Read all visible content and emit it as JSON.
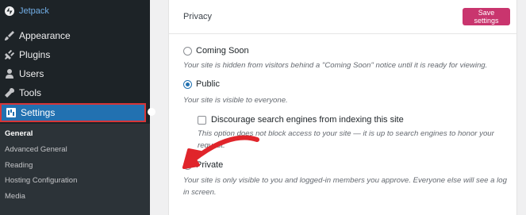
{
  "sidebar": {
    "items": [
      {
        "label": "Jetpack",
        "icon": "jetpack-icon"
      },
      {
        "label": "Appearance",
        "icon": "paintbrush-icon"
      },
      {
        "label": "Plugins",
        "icon": "plug-icon"
      },
      {
        "label": "Users",
        "icon": "users-icon"
      },
      {
        "label": "Tools",
        "icon": "wrench-icon"
      },
      {
        "label": "Settings",
        "icon": "settings-icon"
      }
    ],
    "submenu": [
      "General",
      "Advanced General",
      "Reading",
      "Hosting Configuration",
      "Media"
    ]
  },
  "privacy": {
    "title": "Privacy",
    "save_label": "Save settings",
    "coming_soon_label": "Coming Soon",
    "coming_soon_desc": "Your site is hidden from visitors behind a \"Coming Soon\" notice until it is ready for viewing.",
    "public_label": "Public",
    "public_desc": "Your site is visible to everyone.",
    "discourage_label": "Discourage search engines from indexing this site",
    "discourage_desc_1": "This option does not block access to your site — it is up to search engines to honor your",
    "discourage_desc_2": "request.",
    "private_label": "Private",
    "private_desc_1": "Your site is only visible to you and logged-in members you approve. Everyone else will see a log",
    "private_desc_2": "in screen.",
    "selected": "Public"
  },
  "colors": {
    "sidebar_bg": "#1d2327",
    "active_bg": "#2271b1",
    "highlight_border": "#d63638",
    "save_button": "#c9356e",
    "arrow": "#e0252b"
  }
}
